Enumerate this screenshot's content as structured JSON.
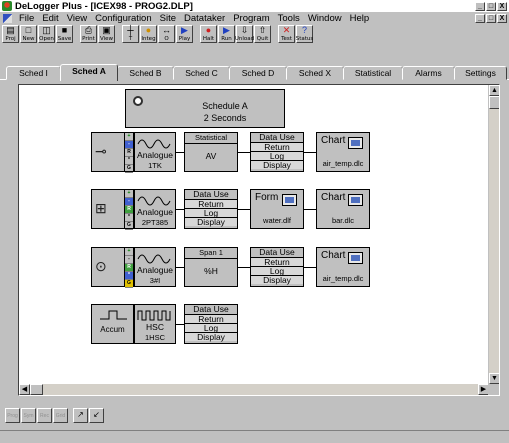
{
  "window": {
    "title": "DeLogger Plus - [ICEX98 - PROG2.DLP]",
    "controls": [
      "_",
      "□",
      "X"
    ],
    "doc_controls": [
      "_",
      "□",
      "X"
    ]
  },
  "menu": [
    "File",
    "Edit",
    "View",
    "Configuration",
    "Site",
    "Datataker",
    "Program",
    "Tools",
    "Window",
    "Help"
  ],
  "toolbar": [
    {
      "icon": "folder-icon",
      "label": "Proj"
    },
    {
      "icon": "new-file-icon",
      "label": "New"
    },
    {
      "icon": "open-folder-icon",
      "label": "Open"
    },
    {
      "icon": "save-disk-icon",
      "label": "Save"
    },
    {
      "icon": "printer-icon",
      "label": "Print"
    },
    {
      "icon": "print-preview-icon",
      "label": "View"
    },
    {
      "icon": "ruler-icon",
      "label": "T"
    },
    {
      "icon": "integrate-icon",
      "label": "Integ"
    },
    {
      "icon": "o-icon",
      "label": "O"
    },
    {
      "icon": "play-icon",
      "label": "Play"
    },
    {
      "icon": "halt-icon",
      "label": "Halt"
    },
    {
      "icon": "run-icon",
      "label": "Run"
    },
    {
      "icon": "unload-icon",
      "label": "Unload"
    },
    {
      "icon": "quit-icon",
      "label": "Quit"
    },
    {
      "icon": "test-icon",
      "label": "Test"
    },
    {
      "icon": "status-icon",
      "label": "Status"
    }
  ],
  "tabs": [
    "Sched I",
    "Sched A",
    "Sched B",
    "Sched C",
    "Sched D",
    "Sched X",
    "Statistical",
    "Alarms",
    "Settings"
  ],
  "active_tab": "Sched A",
  "schedule": {
    "title": "Schedule A",
    "interval": "2 Seconds"
  },
  "rows": [
    {
      "channel": {
        "name": "Analogue",
        "id": "1TK"
      },
      "stat": {
        "header": "Statistical",
        "body": "AV"
      },
      "datause": {
        "header": "Data Use",
        "items": [
          "Return",
          "Log",
          "Display"
        ]
      },
      "output": {
        "label": "Chart",
        "file": "air_temp.dlc"
      }
    },
    {
      "channel": {
        "name": "Analogue",
        "id": "2PT385"
      },
      "datause": {
        "header": "Data Use",
        "items": [
          "Return",
          "Log",
          "Display"
        ]
      },
      "form": {
        "label": "Form",
        "file": "water.dlf"
      },
      "output": {
        "label": "Chart",
        "file": "bar.dlc"
      }
    },
    {
      "channel": {
        "name": "Analogue",
        "id": "3#I"
      },
      "stat": {
        "header": "Span 1",
        "body": "%H"
      },
      "datause": {
        "header": "Data Use",
        "items": [
          "Return",
          "Log",
          "Display"
        ]
      },
      "output": {
        "label": "Chart",
        "file": "air_temp.dlc"
      }
    },
    {
      "sensor_label": "Accum",
      "channel": {
        "name": "HSC",
        "id": "1HSC"
      },
      "datause": {
        "header": "Data Use",
        "items": [
          "Return",
          "Log",
          "Display"
        ]
      }
    }
  ],
  "sensor_bars": [
    "+",
    "-",
    "R",
    "*",
    "G"
  ],
  "bottom_buttons": [
    "Prog",
    "Sym",
    "Rec",
    "Grid",
    "↗",
    "↙"
  ]
}
